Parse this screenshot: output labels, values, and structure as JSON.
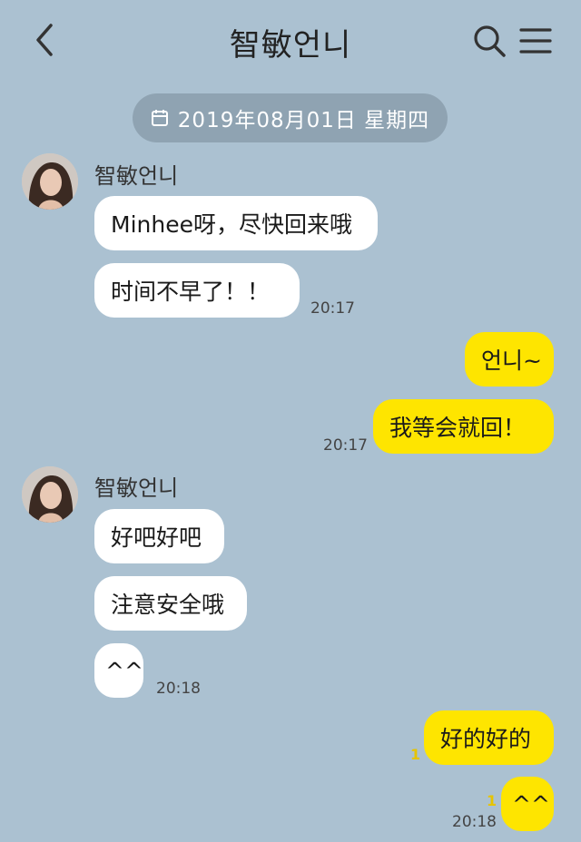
{
  "header": {
    "title": "智敏언니",
    "back_icon": "chevron-left-icon",
    "search_icon": "search-icon",
    "menu_icon": "hamburger-menu-icon"
  },
  "date_divider": {
    "icon": "calendar-icon",
    "text": "2019年08月01日 星期四"
  },
  "contact": {
    "name": "智敏언니",
    "avatar_icon": "avatar-photo"
  },
  "groups": [
    {
      "side": "in",
      "sender": "智敏언니",
      "messages": [
        "Minhee呀，尽快回来哦",
        "时间不早了！！"
      ],
      "time": "20:17"
    },
    {
      "side": "out",
      "messages": [
        "언니~",
        "我等会就回！"
      ],
      "time": "20:17"
    },
    {
      "side": "in",
      "sender": "智敏언니",
      "messages": [
        "好吧好吧",
        "注意安全哦",
        "^^"
      ],
      "time": "20:18"
    },
    {
      "side": "out",
      "messages": [
        "好的好的",
        "^^"
      ],
      "read_markers": [
        "1",
        "1"
      ],
      "time": "20:18"
    }
  ],
  "colors": {
    "background": "#abc1d1",
    "incoming_bubble": "#ffffff",
    "outgoing_bubble": "#fee500",
    "date_pill": "#8fa3b2"
  }
}
